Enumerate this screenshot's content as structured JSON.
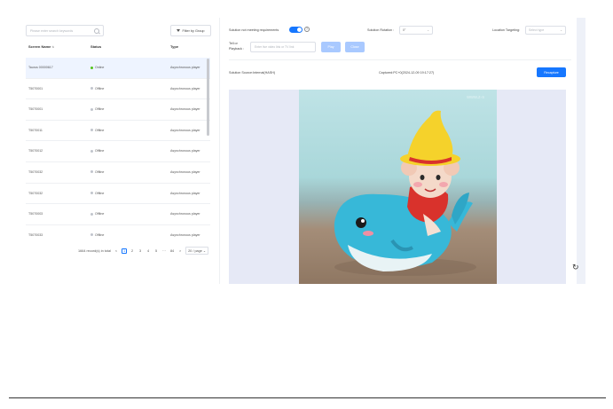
{
  "search": {
    "placeholder": "Please enter search keywords"
  },
  "filter": {
    "label": "Filter by Group"
  },
  "table": {
    "headers": {
      "name": "Screen Name",
      "status": "Status",
      "type": "Type"
    },
    "rows": [
      {
        "name": "Taurus 00000617",
        "status": "Online",
        "type": "Asynchronous player"
      },
      {
        "name": "T5070001",
        "status": "Offline",
        "type": "Asynchronous player"
      },
      {
        "name": "T5070001",
        "status": "Offline",
        "type": "Asynchronous player"
      },
      {
        "name": "T5070011",
        "status": "Offline",
        "type": "Asynchronous player"
      },
      {
        "name": "T5070012",
        "status": "Offline",
        "type": "Asynchronous player"
      },
      {
        "name": "T5070032",
        "status": "Offline",
        "type": "Asynchronous player"
      },
      {
        "name": "T5070032",
        "status": "Offline",
        "type": "Asynchronous player"
      },
      {
        "name": "T5070003",
        "status": "Offline",
        "type": "Asynchronous player"
      },
      {
        "name": "T5070033",
        "status": "Offline",
        "type": "Asynchronous player"
      }
    ]
  },
  "pagination": {
    "total": "1664 record(s) in total",
    "pages": [
      "1",
      "2",
      "3",
      "4",
      "5",
      "···",
      "84"
    ],
    "page_size": "20 / page",
    "prev": "<",
    "next": ">",
    "chevron": "⌄"
  },
  "controls": {
    "solution_label": "Solution not meeting requirements",
    "help": "?",
    "rotation_label": "Solution Rotation :",
    "rotation_value": "0°",
    "targeting_label": "Location Targeting:",
    "targeting_placeholder": "Select type",
    "chevron": "⌄",
    "live_label_1": "Tell or",
    "live_label_2": "Playback :",
    "url_placeholder": "Enter live video link or TV link",
    "play": "Play",
    "close": "Close",
    "solution_source": "Solution Source:Internal(HASH)",
    "capture_time": "Captured:PC+0(2024-12-09 19:17:27)",
    "recapture": "Recapture"
  },
  "watermark": "www.z-s",
  "refresh_icon": "↻",
  "colors": {
    "primary": "#1677ff",
    "online": "#52c41a",
    "offline": "#c0c4cc"
  }
}
